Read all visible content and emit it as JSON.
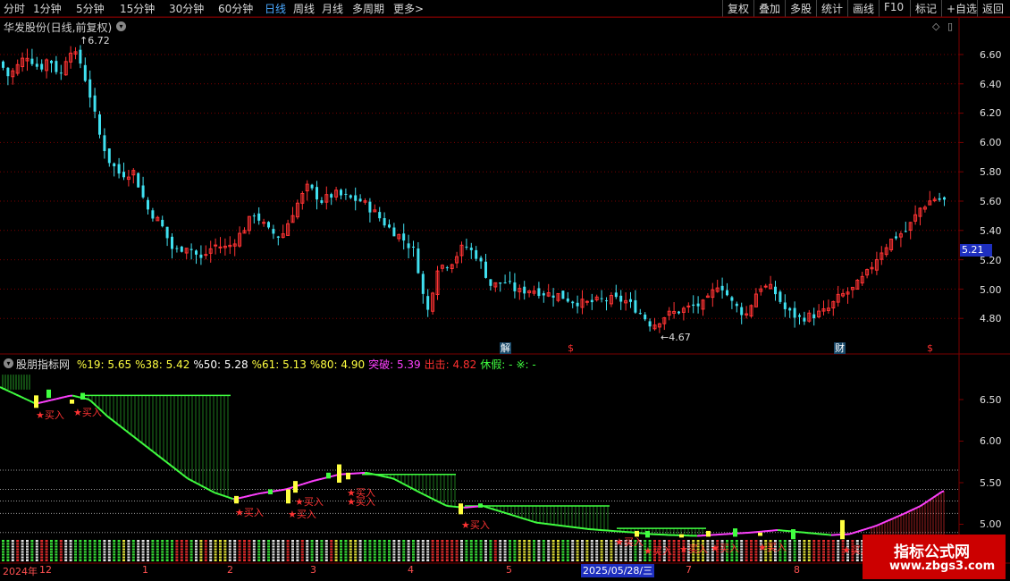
{
  "toolbar": {
    "periods": [
      "分时",
      "1分钟",
      "5分钟",
      "15分钟",
      "30分钟",
      "60分钟",
      "日线",
      "周线",
      "月线",
      "多周期",
      "更多"
    ],
    "more_arrow": ">",
    "right_buttons": [
      "复权",
      "叠加",
      "多股",
      "统计",
      "画线",
      "F10",
      "标记",
      "+自选",
      "返回"
    ]
  },
  "main_chart": {
    "title": "华发股份(日线,前复权)",
    "title_icon": "chevron-down-icon",
    "top_right_icons": [
      "diamond-icon",
      "copy-icon"
    ],
    "high_label": "6.72",
    "low_label": "4.67",
    "current_price": "5.21",
    "y_ticks": [
      "6.60",
      "6.40",
      "6.20",
      "6.00",
      "5.80",
      "5.60",
      "5.40",
      "5.20",
      "5.00",
      "4.80"
    ],
    "events": [
      {
        "text": "解",
        "color": "#ffffff",
        "bg": "#1a4a6a"
      },
      {
        "text": "$",
        "color": "#ff3030",
        "bg": "transparent"
      },
      {
        "text": "财",
        "color": "#ffffff",
        "bg": "#1a4a6a"
      },
      {
        "text": "$",
        "color": "#ff3030",
        "bg": "transparent"
      }
    ]
  },
  "indicator": {
    "name": "股朋指标网",
    "items": [
      {
        "text": "%19: 5.65",
        "color": "#ffff40"
      },
      {
        "text": "%38: 5.42",
        "color": "#ffff40"
      },
      {
        "text": "%50: 5.28",
        "color": "#ffffff"
      },
      {
        "text": "%61: 5.13",
        "color": "#ffff40"
      },
      {
        "text": "%80: 4.90",
        "color": "#ffff40"
      },
      {
        "text": "突破: 5.39",
        "color": "#ff40ff"
      },
      {
        "text": "出击: 4.82",
        "color": "#ff3030"
      },
      {
        "text": "休假: -",
        "color": "#40ff40"
      },
      {
        "text": "※: -",
        "color": "#40ff40"
      }
    ],
    "y_ticks": [
      "6.50",
      "6.00",
      "5.50",
      "5.00"
    ],
    "buy_label": "★买入"
  },
  "x_axis": {
    "labels": [
      "2024年",
      "12",
      "1",
      "2",
      "3",
      "4",
      "5",
      "2025/05/28/三",
      "7",
      "8"
    ]
  },
  "watermark": {
    "main": "指标公式网",
    "sub": "www.zbgs3.com"
  },
  "colors": {
    "up": "#ff3333",
    "down": "#40e0f0",
    "rise_line": "#ff40ff",
    "fall_line": "#40ff40",
    "signal": "#ffff40",
    "grid": "#7a0000",
    "axis_bg": "#000000",
    "brand": "#cc0000"
  }
}
